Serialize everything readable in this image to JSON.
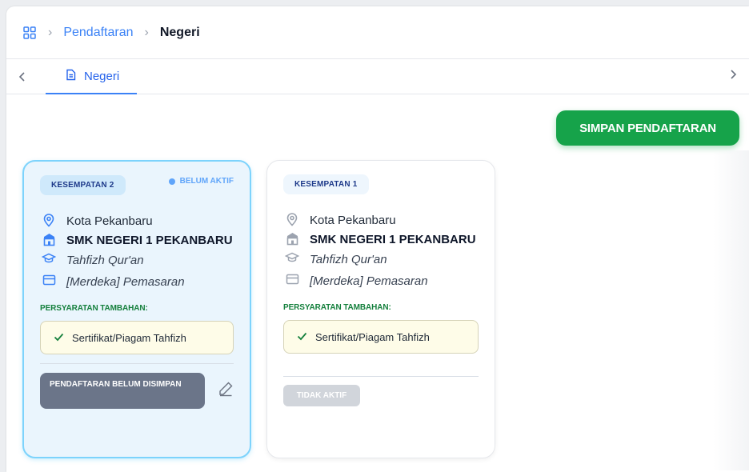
{
  "breadcrumb": {
    "home_icon": "grid-icon",
    "link": "Pendaftaran",
    "current": "Negeri"
  },
  "tabs": [
    {
      "label": "Negeri",
      "icon": "document-icon",
      "active": true
    }
  ],
  "actions": {
    "save_label": "SIMPAN PENDAFTARAN"
  },
  "cards": [
    {
      "badge": "KESEMPATAN 2",
      "status": "BELUM AKTIF",
      "city": "Kota Pekanbaru",
      "school": "SMK NEGERI 1 PEKANBARU",
      "major": "Tahfizh Qur'an",
      "curriculum": "[Merdeka] Pemasaran",
      "requirements_title": "PERSYARATAN TAMBAHAN:",
      "requirement": "Sertifikat/Piagam Tahfizh",
      "footer_label": "PENDAFTARAN BELUM DISIMPAN"
    },
    {
      "badge": "KESEMPATAN 1",
      "city": "Kota Pekanbaru",
      "school": "SMK NEGERI 1 PEKANBARU",
      "major": "Tahfizh Qur'an",
      "curriculum": "[Merdeka] Pemasaran",
      "requirements_title": "PERSYARATAN TAMBAHAN:",
      "requirement": "Sertifikat/Piagam Tahfizh",
      "footer_label": "TIDAK AKTIF"
    }
  ],
  "colors": {
    "accent": "#3b82f6",
    "success": "#16a34a",
    "active_card_bg": "#eaf5fd",
    "active_card_border": "#7dd3fc"
  }
}
